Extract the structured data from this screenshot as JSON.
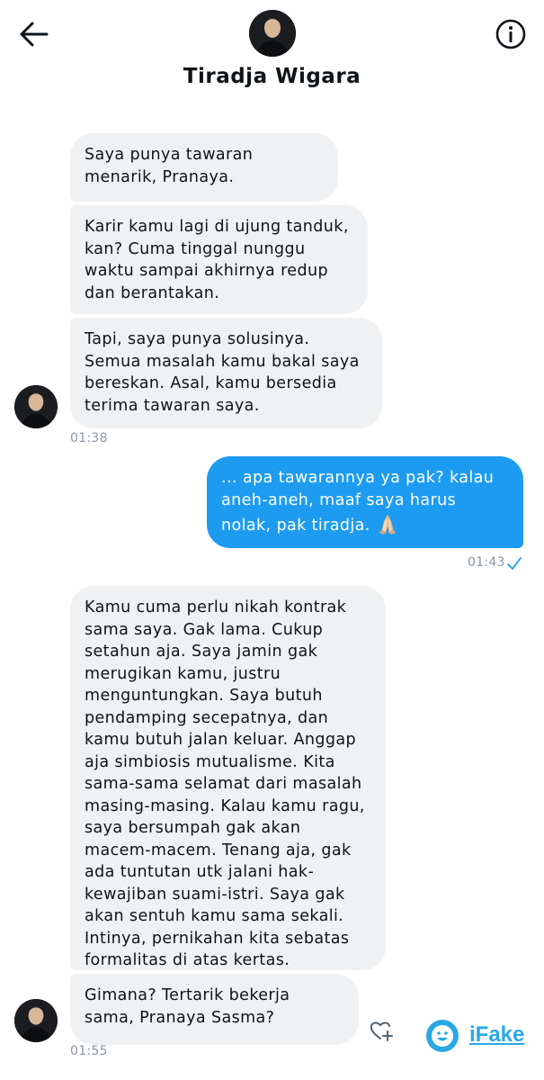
{
  "header": {
    "contact_name": "Tiradja Wigara",
    "back_icon": "arrow-left-icon",
    "info_icon": "info-circle-icon"
  },
  "messages": [
    {
      "direction": "incoming",
      "text": "Saya punya tawaran menarik, Pranaya."
    },
    {
      "direction": "incoming",
      "text": "Karir kamu lagi di ujung tanduk, kan? Cuma tinggal nunggu waktu sampai akhirnya redup dan berantakan."
    },
    {
      "direction": "incoming",
      "text": "Tapi, saya punya solusinya. Semua masalah kamu bakal saya bereskan. Asal, kamu bersedia terima tawaran saya."
    },
    {
      "direction": "outgoing",
      "text": "... apa tawarannya ya pak? kalau aneh-aneh, maaf saya harus nolak, pak tiradja.",
      "emoji": "folded-hands-icon"
    },
    {
      "direction": "incoming",
      "text": "Kamu cuma perlu nikah kontrak sama saya. Gak lama. Cukup setahun aja. Saya jamin gak merugikan kamu, justru menguntungkan. Saya butuh pendamping secepatnya, dan kamu butuh jalan keluar. Anggap aja simbiosis mutualisme. Kita sama-sama selamat dari masalah masing-masing. Kalau kamu ragu, saya bersumpah gak akan macem-macem. Tenang aja, gak ada tuntutan utk jalani hak-kewajiban suami-istri. Saya gak akan sentuh kamu sama sekali. Intinya, pernikahan kita sebatas formalitas di atas kertas."
    },
    {
      "direction": "incoming",
      "text": "Gimana? Tertarik bekerja sama, Pranaya Sasma?"
    }
  ],
  "timestamps": [
    "01:38",
    "01:43",
    "01:55"
  ],
  "watermark": {
    "text": "iFake"
  },
  "colors": {
    "outgoing_bubble": "#1d9bf0",
    "incoming_bubble": "#eff1f3",
    "timestamp": "#8b98a5",
    "watermark": "#2aa8e6"
  }
}
